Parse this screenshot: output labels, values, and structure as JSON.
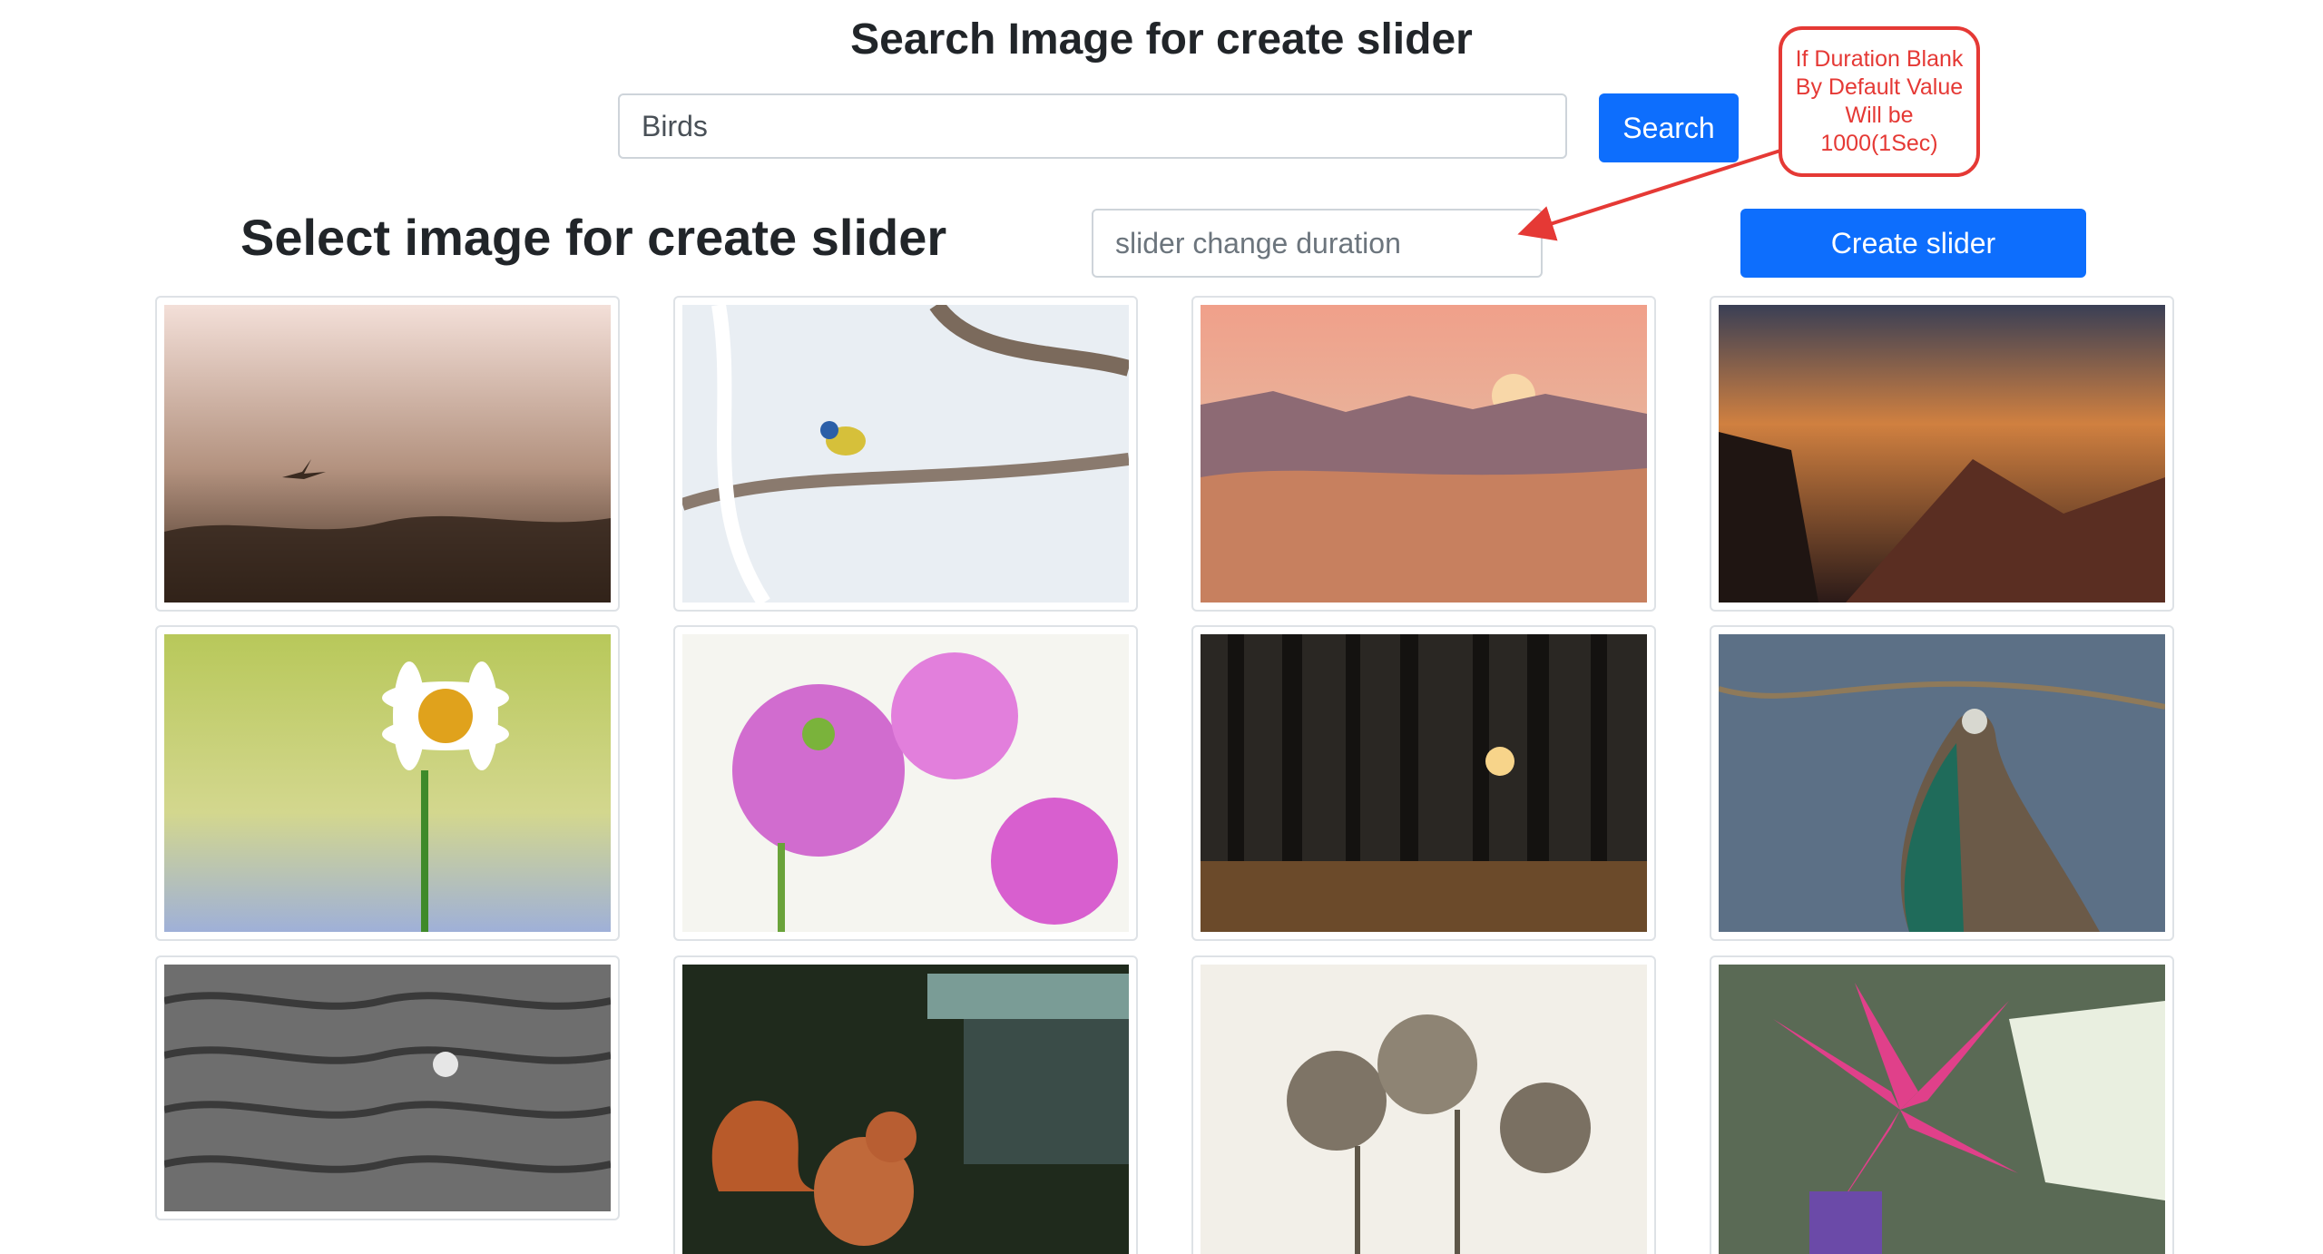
{
  "header": {
    "title": "Search Image for create slider"
  },
  "search": {
    "value": "Birds",
    "button_label": "Search"
  },
  "gallery": {
    "title": "Select image for create slider",
    "duration_placeholder": "slider change duration",
    "create_label": "Create slider",
    "images": [
      {
        "subject": "heron in foggy meadow"
      },
      {
        "subject": "blue tit on frosty branch"
      },
      {
        "subject": "desert dunes at sunset"
      },
      {
        "subject": "mountain cliffs at dusk"
      },
      {
        "subject": "daisy flower"
      },
      {
        "subject": "pink poppies"
      },
      {
        "subject": "forest with sun rays"
      },
      {
        "subject": "peacock"
      },
      {
        "subject": "snowflake on knitted wool"
      },
      {
        "subject": "red squirrel at feeder"
      },
      {
        "subject": "sepia poppies"
      },
      {
        "subject": "pink lily"
      }
    ]
  },
  "annotation": {
    "text": "If Duration Blank\nBy Default Value\nWill be\n1000(1Sec)",
    "color": "#e53935"
  },
  "colors": {
    "primary": "#0d6efd"
  }
}
